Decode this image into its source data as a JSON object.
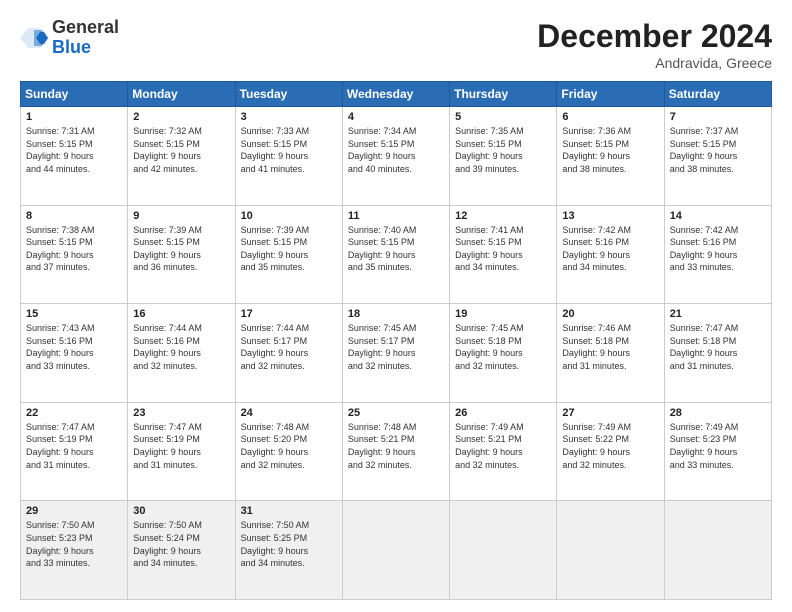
{
  "logo": {
    "general": "General",
    "blue": "Blue"
  },
  "header": {
    "month_year": "December 2024",
    "location": "Andravida, Greece"
  },
  "weekdays": [
    "Sunday",
    "Monday",
    "Tuesday",
    "Wednesday",
    "Thursday",
    "Friday",
    "Saturday"
  ],
  "weeks": [
    [
      {
        "day": "1",
        "sunrise": "7:31 AM",
        "sunset": "5:15 PM",
        "daylight": "9 hours and 44 minutes."
      },
      {
        "day": "2",
        "sunrise": "7:32 AM",
        "sunset": "5:15 PM",
        "daylight": "9 hours and 42 minutes."
      },
      {
        "day": "3",
        "sunrise": "7:33 AM",
        "sunset": "5:15 PM",
        "daylight": "9 hours and 41 minutes."
      },
      {
        "day": "4",
        "sunrise": "7:34 AM",
        "sunset": "5:15 PM",
        "daylight": "9 hours and 40 minutes."
      },
      {
        "day": "5",
        "sunrise": "7:35 AM",
        "sunset": "5:15 PM",
        "daylight": "9 hours and 39 minutes."
      },
      {
        "day": "6",
        "sunrise": "7:36 AM",
        "sunset": "5:15 PM",
        "daylight": "9 hours and 38 minutes."
      },
      {
        "day": "7",
        "sunrise": "7:37 AM",
        "sunset": "5:15 PM",
        "daylight": "9 hours and 38 minutes."
      }
    ],
    [
      {
        "day": "8",
        "sunrise": "7:38 AM",
        "sunset": "5:15 PM",
        "daylight": "9 hours and 37 minutes."
      },
      {
        "day": "9",
        "sunrise": "7:39 AM",
        "sunset": "5:15 PM",
        "daylight": "9 hours and 36 minutes."
      },
      {
        "day": "10",
        "sunrise": "7:39 AM",
        "sunset": "5:15 PM",
        "daylight": "9 hours and 35 minutes."
      },
      {
        "day": "11",
        "sunrise": "7:40 AM",
        "sunset": "5:15 PM",
        "daylight": "9 hours and 35 minutes."
      },
      {
        "day": "12",
        "sunrise": "7:41 AM",
        "sunset": "5:15 PM",
        "daylight": "9 hours and 34 minutes."
      },
      {
        "day": "13",
        "sunrise": "7:42 AM",
        "sunset": "5:16 PM",
        "daylight": "9 hours and 34 minutes."
      },
      {
        "day": "14",
        "sunrise": "7:42 AM",
        "sunset": "5:16 PM",
        "daylight": "9 hours and 33 minutes."
      }
    ],
    [
      {
        "day": "15",
        "sunrise": "7:43 AM",
        "sunset": "5:16 PM",
        "daylight": "9 hours and 33 minutes."
      },
      {
        "day": "16",
        "sunrise": "7:44 AM",
        "sunset": "5:16 PM",
        "daylight": "9 hours and 32 minutes."
      },
      {
        "day": "17",
        "sunrise": "7:44 AM",
        "sunset": "5:17 PM",
        "daylight": "9 hours and 32 minutes."
      },
      {
        "day": "18",
        "sunrise": "7:45 AM",
        "sunset": "5:17 PM",
        "daylight": "9 hours and 32 minutes."
      },
      {
        "day": "19",
        "sunrise": "7:45 AM",
        "sunset": "5:18 PM",
        "daylight": "9 hours and 32 minutes."
      },
      {
        "day": "20",
        "sunrise": "7:46 AM",
        "sunset": "5:18 PM",
        "daylight": "9 hours and 31 minutes."
      },
      {
        "day": "21",
        "sunrise": "7:47 AM",
        "sunset": "5:18 PM",
        "daylight": "9 hours and 31 minutes."
      }
    ],
    [
      {
        "day": "22",
        "sunrise": "7:47 AM",
        "sunset": "5:19 PM",
        "daylight": "9 hours and 31 minutes."
      },
      {
        "day": "23",
        "sunrise": "7:47 AM",
        "sunset": "5:19 PM",
        "daylight": "9 hours and 31 minutes."
      },
      {
        "day": "24",
        "sunrise": "7:48 AM",
        "sunset": "5:20 PM",
        "daylight": "9 hours and 32 minutes."
      },
      {
        "day": "25",
        "sunrise": "7:48 AM",
        "sunset": "5:21 PM",
        "daylight": "9 hours and 32 minutes."
      },
      {
        "day": "26",
        "sunrise": "7:49 AM",
        "sunset": "5:21 PM",
        "daylight": "9 hours and 32 minutes."
      },
      {
        "day": "27",
        "sunrise": "7:49 AM",
        "sunset": "5:22 PM",
        "daylight": "9 hours and 32 minutes."
      },
      {
        "day": "28",
        "sunrise": "7:49 AM",
        "sunset": "5:23 PM",
        "daylight": "9 hours and 33 minutes."
      }
    ],
    [
      {
        "day": "29",
        "sunrise": "7:50 AM",
        "sunset": "5:23 PM",
        "daylight": "9 hours and 33 minutes."
      },
      {
        "day": "30",
        "sunrise": "7:50 AM",
        "sunset": "5:24 PM",
        "daylight": "9 hours and 34 minutes."
      },
      {
        "day": "31",
        "sunrise": "7:50 AM",
        "sunset": "5:25 PM",
        "daylight": "9 hours and 34 minutes."
      },
      null,
      null,
      null,
      null
    ]
  ],
  "labels": {
    "sunrise": "Sunrise:",
    "sunset": "Sunset:",
    "daylight": "Daylight: "
  }
}
